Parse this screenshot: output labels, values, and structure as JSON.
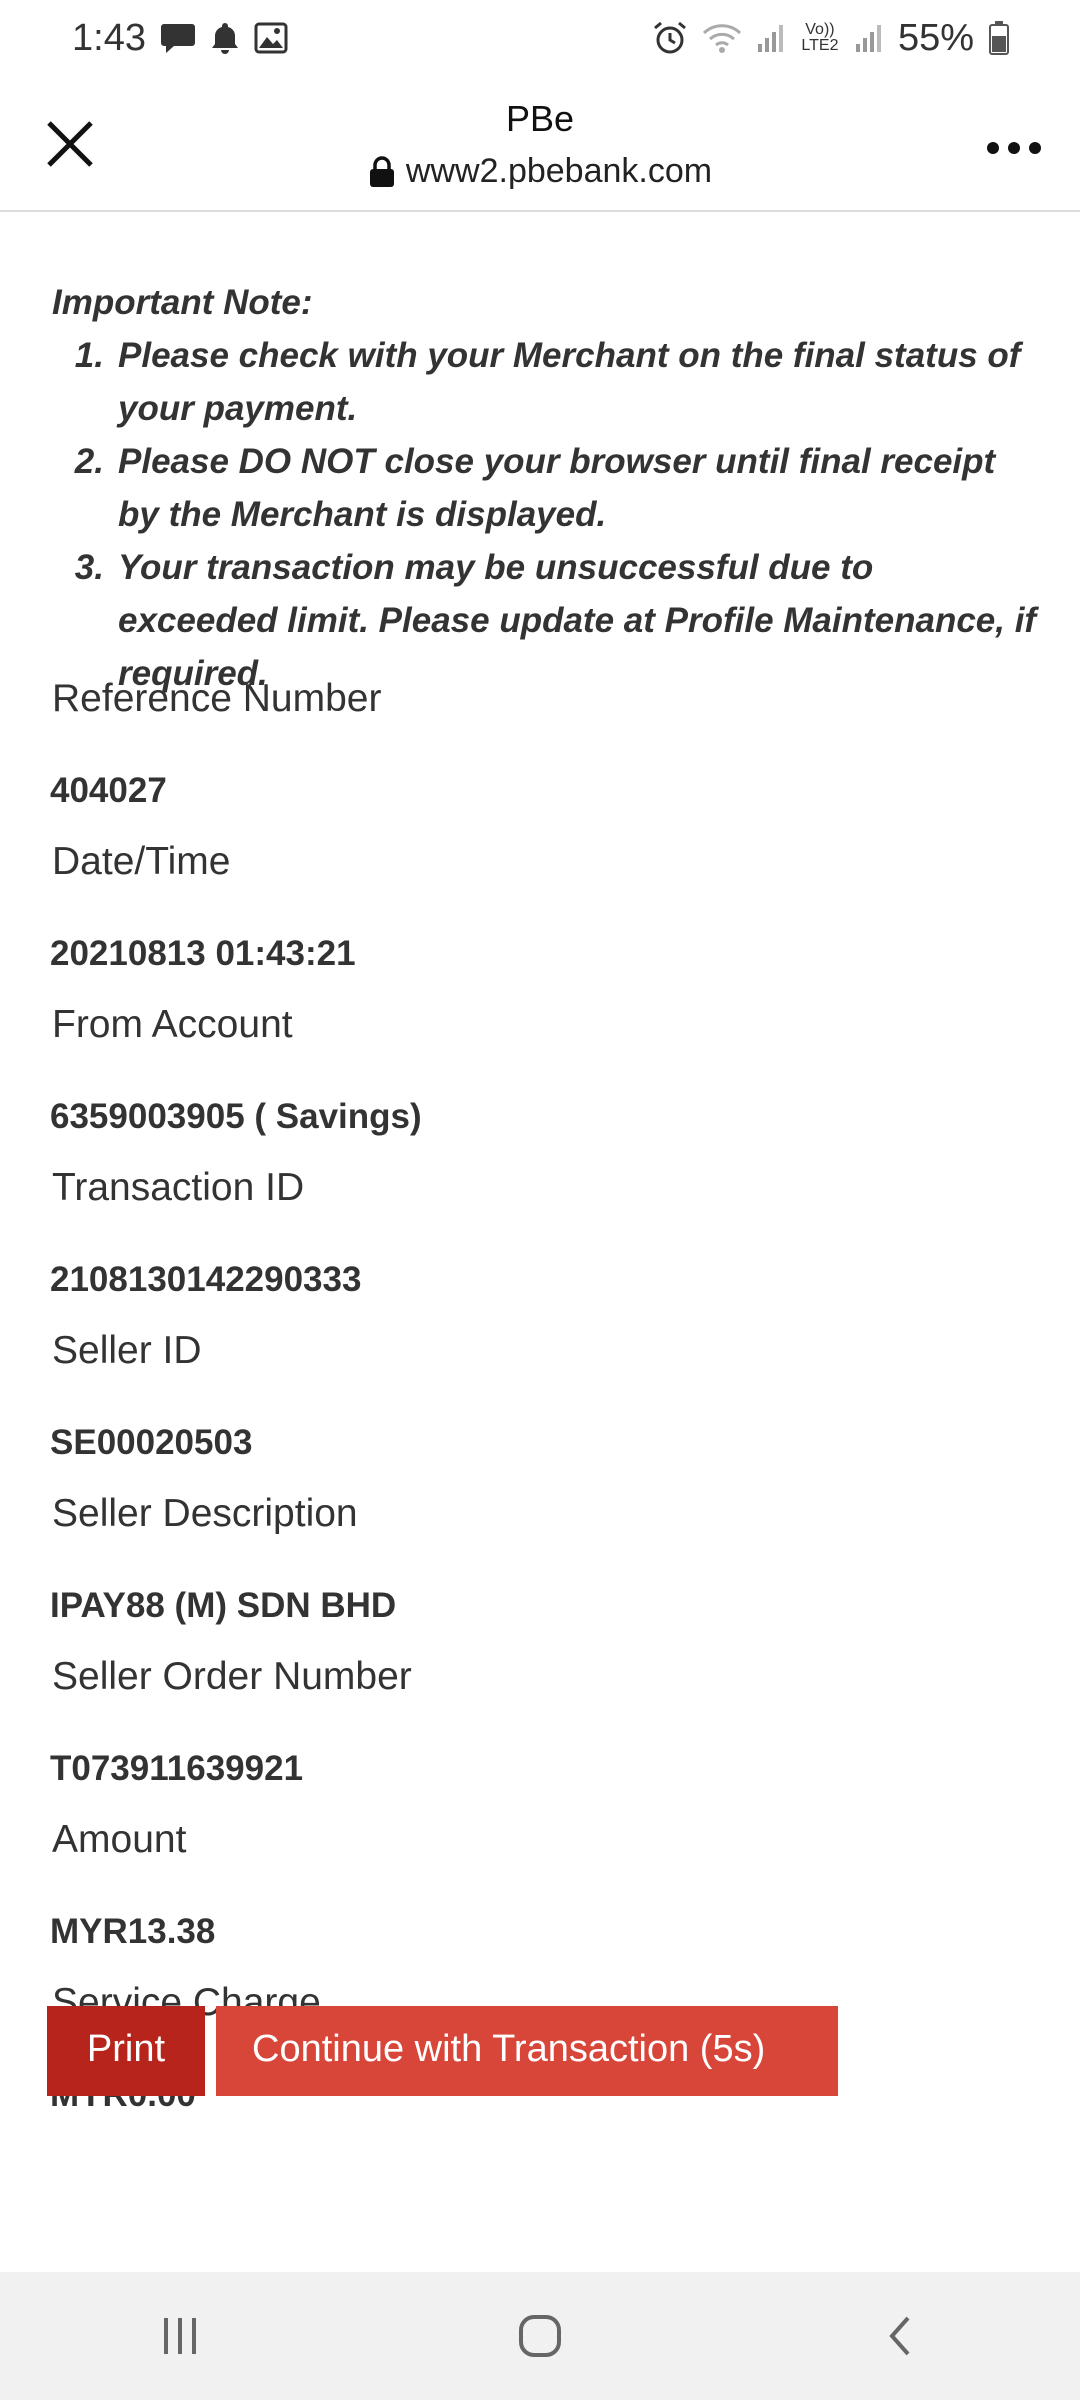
{
  "status_bar": {
    "time": "1:43",
    "battery": "55%",
    "network": "Vo)) LTE2"
  },
  "header": {
    "title": "PBe",
    "url": "www2.pbebank.com"
  },
  "note": {
    "heading": "Important Note:",
    "items": [
      {
        "num": "1.",
        "text": "Please check with your Merchant on the final status of your payment."
      },
      {
        "num": "2.",
        "text": "Please DO NOT close your browser until final receipt by the Merchant is displayed."
      },
      {
        "num": "3.",
        "text": "Your transaction may be unsuccessful due to exceeded limit. Please update at Profile Maintenance, if required."
      }
    ]
  },
  "fields": [
    {
      "label": "Reference Number",
      "value": "404027"
    },
    {
      "label": "Date/Time",
      "value": "20210813 01:43:21"
    },
    {
      "label": "From Account",
      "value": "6359003905 ( Savings)"
    },
    {
      "label": "Transaction ID",
      "value": "2108130142290333"
    },
    {
      "label": "Seller ID",
      "value": "SE00020503"
    },
    {
      "label": "Seller Description",
      "value": "IPAY88 (M) SDN BHD"
    },
    {
      "label": "Seller Order Number",
      "value": "T073911639921"
    },
    {
      "label": "Amount",
      "value": "MYR13.38"
    },
    {
      "label": "Service Charge",
      "value": "MYR0.00"
    }
  ],
  "buttons": {
    "print": "Print",
    "continue": "Continue with Transaction (5s)"
  },
  "colors": {
    "print_bg": "#b7241b",
    "continue_bg": "#d8463a",
    "nav_bg": "#f1f1f1"
  },
  "icons": {
    "status_left": [
      "message-icon",
      "notification-bell-icon",
      "image-icon"
    ],
    "status_right": [
      "alarm-icon",
      "wifi-icon",
      "signal-icon",
      "battery-icon"
    ],
    "header": [
      "close-icon",
      "lock-icon",
      "more-menu-icon"
    ],
    "nav": [
      "recent-apps-icon",
      "home-icon",
      "back-icon"
    ]
  }
}
